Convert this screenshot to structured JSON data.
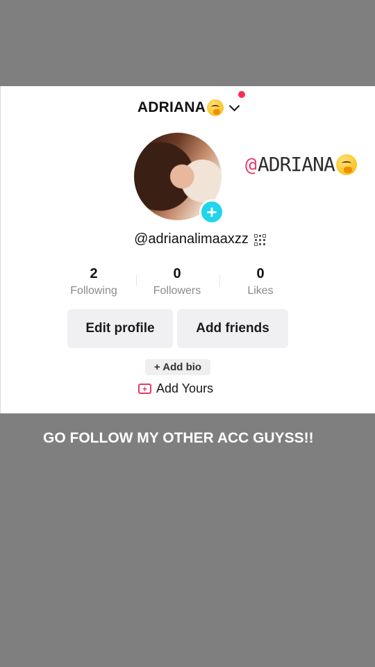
{
  "profile": {
    "display_name": "ADRIANA",
    "handle": "@adrianalimaaxzz",
    "sticker_text": "ADRIANA",
    "sticker_at": "@",
    "stats": [
      {
        "value": "2",
        "label": "Following"
      },
      {
        "value": "0",
        "label": "Followers"
      },
      {
        "value": "0",
        "label": "Likes"
      }
    ],
    "buttons": {
      "edit_profile": "Edit profile",
      "add_friends": "Add friends"
    },
    "add_bio": "+ Add bio",
    "add_yours": "Add Yours"
  },
  "overlay": {
    "caption": "GO FOLLOW MY OTHER ACC GUYSS!!"
  },
  "colors": {
    "accent_cyan": "#20d5ec",
    "notification_red": "#fe2c55",
    "add_yours_pink": "#e13b69",
    "background_gray": "#7f7f7f"
  }
}
